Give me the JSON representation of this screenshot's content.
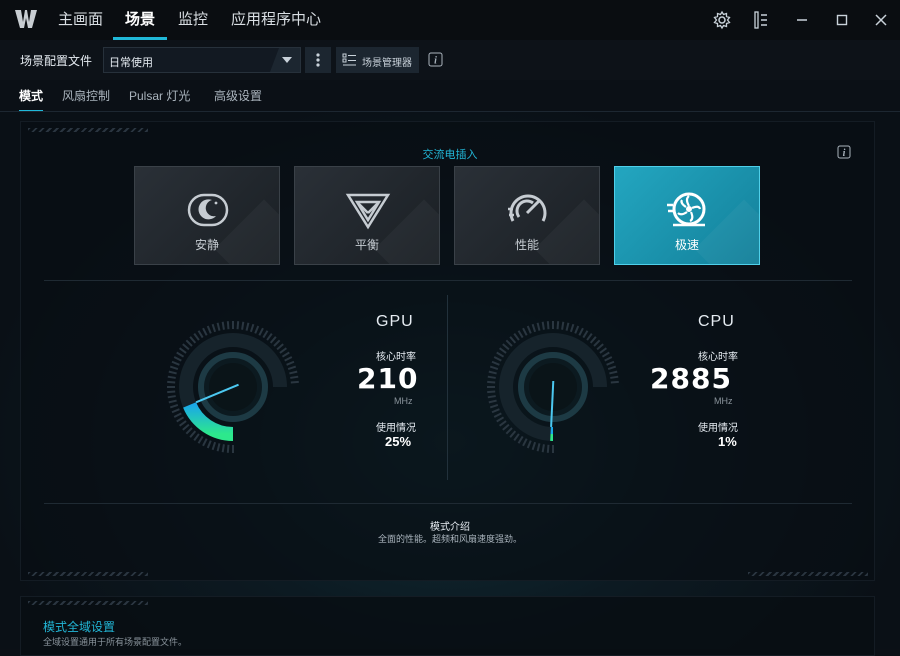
{
  "nav": {
    "tabs": [
      {
        "label": "主画面"
      },
      {
        "label": "场景"
      },
      {
        "label": "监控"
      },
      {
        "label": "应用程序中心"
      }
    ],
    "active_tab": "场景"
  },
  "profile_bar": {
    "label": "场景配置文件",
    "selected": "日常使用",
    "scene_manager_label": "场景管理器"
  },
  "subtabs": [
    {
      "label": "模式"
    },
    {
      "label": "风扇控制"
    },
    {
      "label": "Pulsar 灯光"
    },
    {
      "label": "高级设置"
    }
  ],
  "power_label": "交流电插入",
  "modes": [
    {
      "label": "安静",
      "icon": "quiet-moon-icon"
    },
    {
      "label": "平衡",
      "icon": "balanced-icon"
    },
    {
      "label": "性能",
      "icon": "performance-gauge-icon"
    },
    {
      "label": "极速",
      "icon": "turbo-fan-icon"
    }
  ],
  "active_mode": "极速",
  "gpu": {
    "title": "GPU",
    "clock_label": "核心时率",
    "clock_value": "210",
    "clock_unit": "MHz",
    "usage_label": "使用情况",
    "usage_value": "25%"
  },
  "cpu": {
    "title": "CPU",
    "clock_label": "核心时率",
    "clock_value": "2885",
    "clock_unit": "MHz",
    "usage_label": "使用情况",
    "usage_value": "1%"
  },
  "mode_description": {
    "title": "模式介绍",
    "text": "全面的性能。超频和风扇速度强劲。"
  },
  "global_settings": {
    "title": "模式全域设置",
    "text": "全域设置通用于所有场景配置文件。"
  },
  "colors": {
    "accent": "#20b8d8",
    "active_mode_bg": "#1a93ad"
  }
}
